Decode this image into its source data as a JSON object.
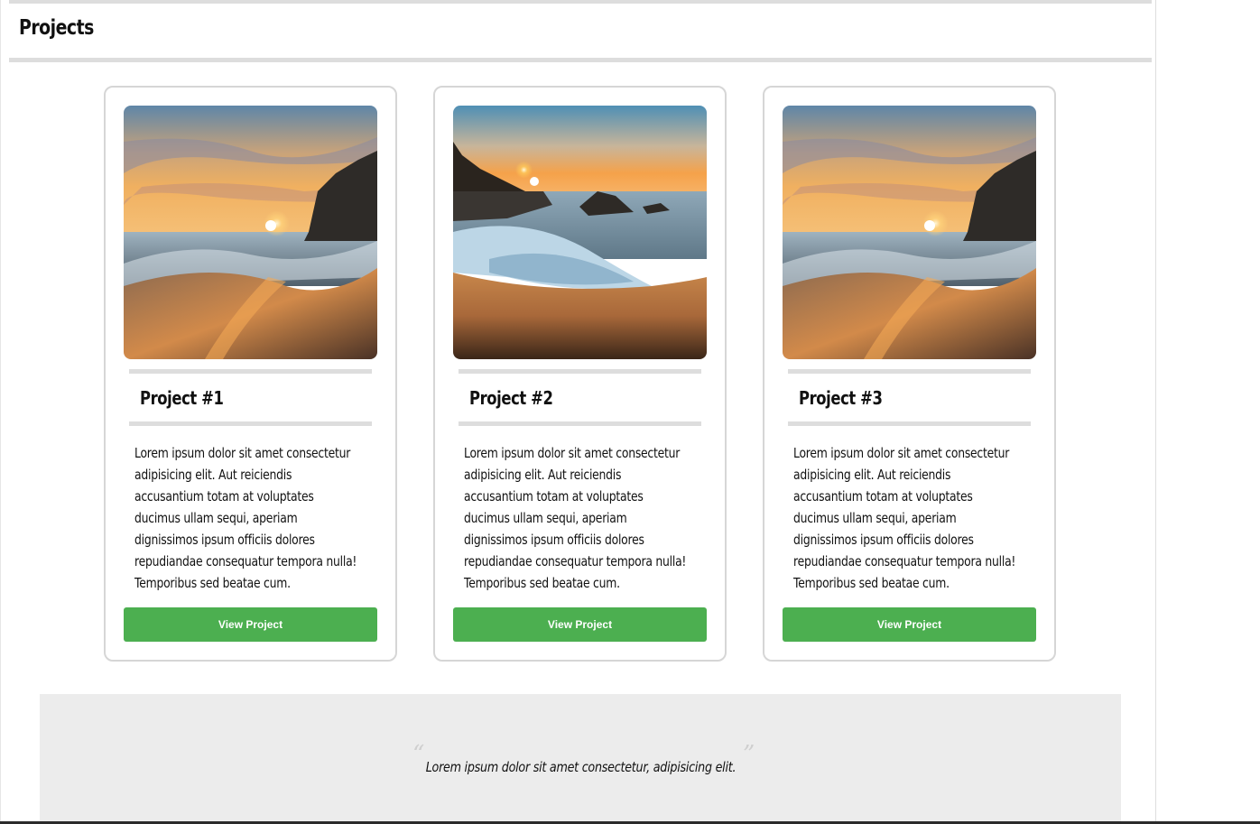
{
  "section": {
    "title": "Projects"
  },
  "projects": [
    {
      "title": "Project #1",
      "description": "Lorem ipsum dolor sit amet consectetur adipisicing elit. Aut reiciendis accusantium totam at voluptates ducimus ullam sequi, aperiam dignissimos ipsum officiis dolores repudiandae consequatur tempora nulla! Temporibus sed beatae cum.",
      "button_label": "View Project",
      "image": "sunset-beach-cliff"
    },
    {
      "title": "Project #2",
      "description": "Lorem ipsum dolor sit amet consectetur adipisicing elit. Aut reiciendis accusantium totam at voluptates ducimus ullam sequi, aperiam dignissimos ipsum officiis dolores repudiandae consequatur tempora nulla! Temporibus sed beatae cum.",
      "button_label": "View Project",
      "image": "sunset-rocky-shore"
    },
    {
      "title": "Project #3",
      "description": "Lorem ipsum dolor sit amet consectetur adipisicing elit. Aut reiciendis accusantium totam at voluptates ducimus ullam sequi, aperiam dignissimos ipsum officiis dolores repudiandae consequatur tempora nulla! Temporibus sed beatae cum.",
      "button_label": "View Project",
      "image": "sunset-beach-cliff"
    }
  ],
  "testimonial": {
    "quote": "Lorem ipsum dolor sit amet consectetur, adipisicing elit."
  },
  "colors": {
    "button": "#4caf50",
    "divider": "#dddddd",
    "quote_band": "#ececec"
  }
}
